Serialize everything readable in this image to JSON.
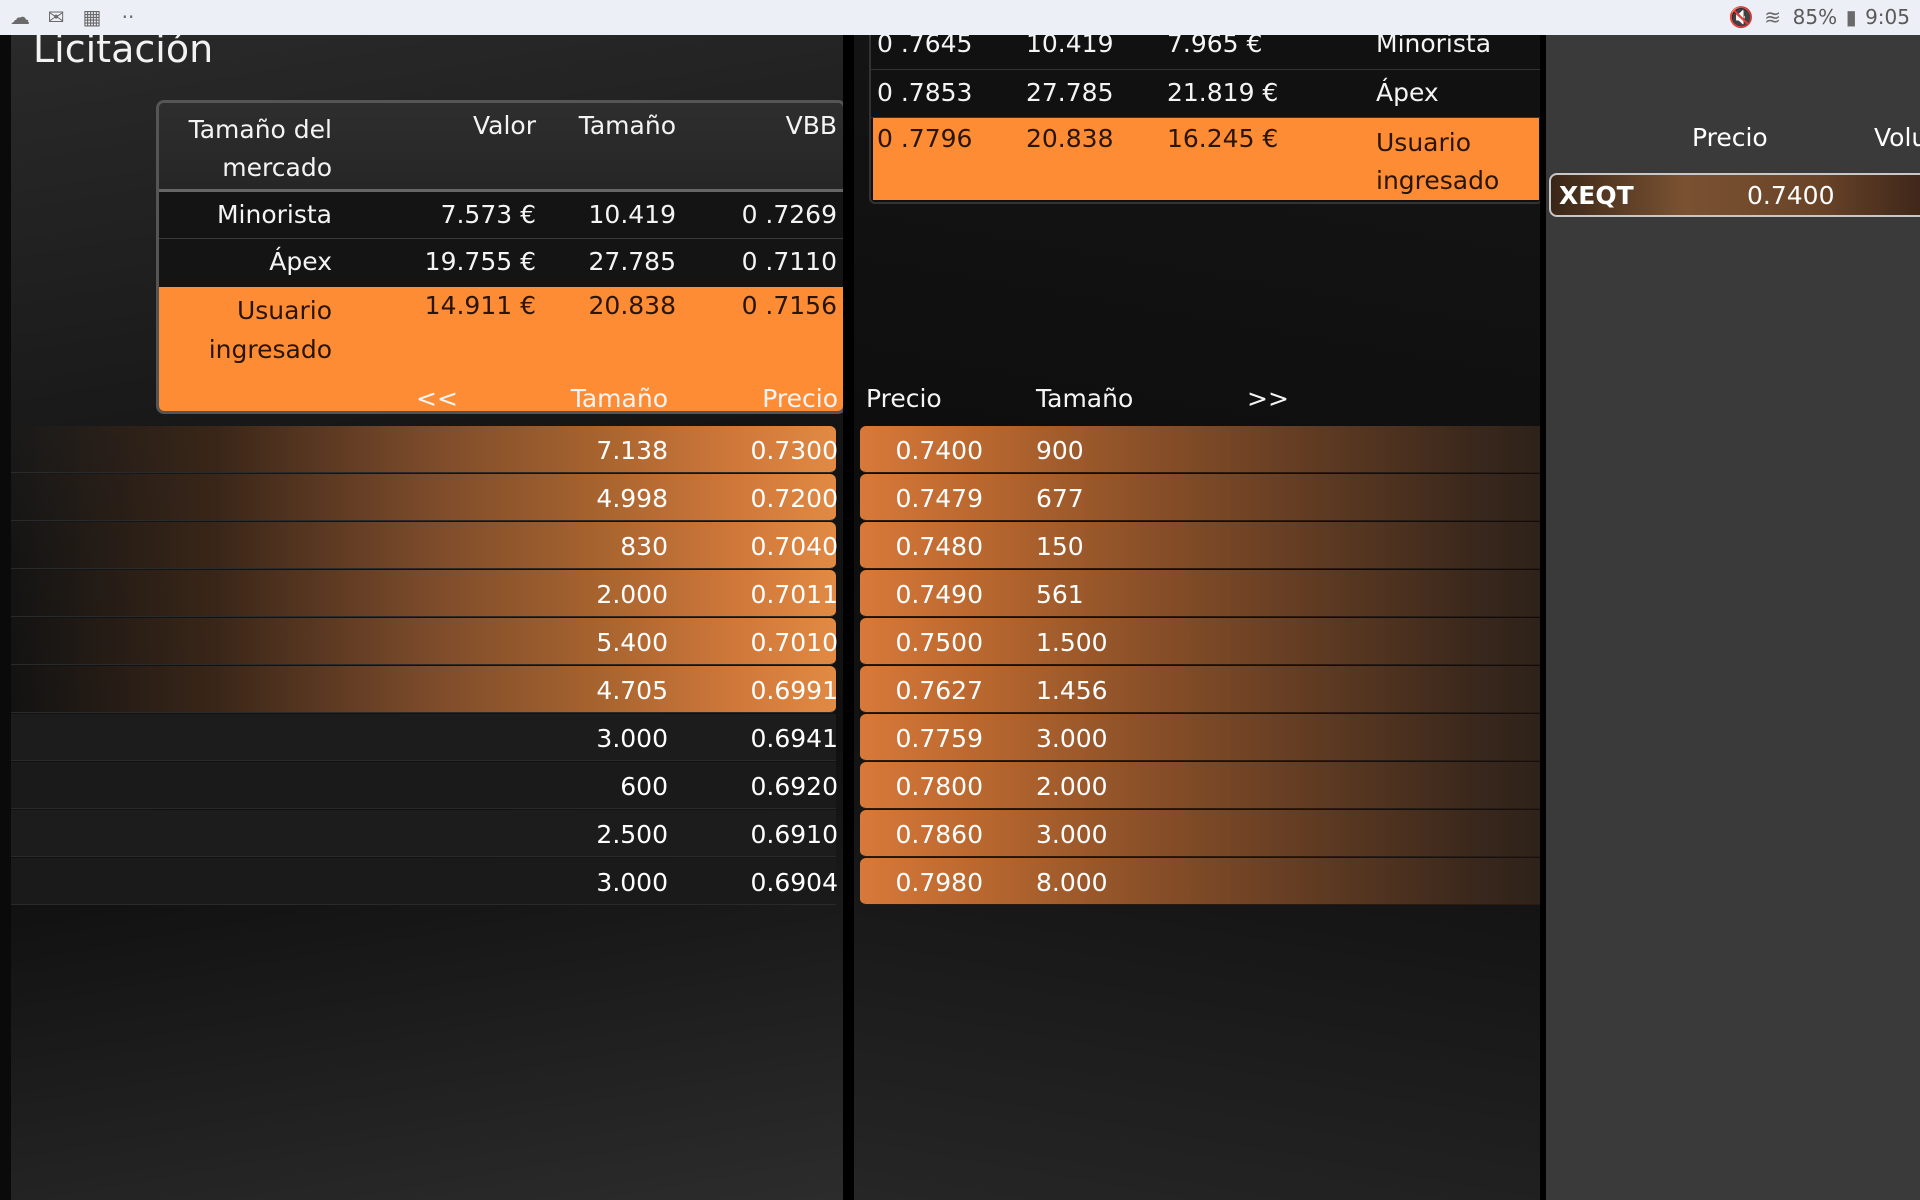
{
  "status_bar": {
    "left_icons": [
      "cloud-icon",
      "mail-icon",
      "gallery-icon",
      "more-dots-icon"
    ],
    "mute_icon": "mute-icon",
    "wifi_icon": "wifi-icon",
    "battery_percent": "85%",
    "battery_icon": "battery-icon",
    "time": "9:05"
  },
  "colors": {
    "accent_orange": "#fe8c34",
    "bar_brown": "#7a4a2a",
    "panel_dark": "#141414",
    "right_panel": "#3a3a3a"
  },
  "bid_panel": {
    "title": "Licitación",
    "summary": {
      "headers": {
        "market_size": "Tamaño del mercado",
        "valor": "Valor",
        "tamano": "Tamaño",
        "vbb": "VBB"
      },
      "rows": [
        {
          "name": "Minorista",
          "valor": "7.573 €",
          "tamano": "10.419",
          "vbb": "0 .7269"
        },
        {
          "name": "Ápex",
          "valor": "19.755 €",
          "tamano": "27.785",
          "vbb": "0 .7110"
        },
        {
          "name": "Usuario ingresado",
          "valor": "14.911 €",
          "tamano": "20.838",
          "vbb": "0 .7156"
        }
      ]
    },
    "ladder_headers": {
      "prev": "<<",
      "tamano": "Tamaño",
      "precio": "Precio"
    },
    "ladder": [
      {
        "size": "7.138",
        "price": "0.7300",
        "highlighted": true,
        "fill": 1.0
      },
      {
        "size": "4.998",
        "price": "0.7200",
        "highlighted": true,
        "fill": 1.0
      },
      {
        "size": "830",
        "price": "0.7040",
        "highlighted": true,
        "fill": 1.0
      },
      {
        "size": "2.000",
        "price": "0.7011",
        "highlighted": true,
        "fill": 1.0
      },
      {
        "size": "5.400",
        "price": "0.7010",
        "highlighted": true,
        "fill": 1.0
      },
      {
        "size": "4.705",
        "price": "0.6991",
        "highlighted": true,
        "fill": 1.0
      },
      {
        "size": "3.000",
        "price": "0.6941",
        "highlighted": false,
        "fill": 0
      },
      {
        "size": "600",
        "price": "0.6920",
        "highlighted": false,
        "fill": 0
      },
      {
        "size": "2.500",
        "price": "0.6910",
        "highlighted": false,
        "fill": 0
      },
      {
        "size": "3.000",
        "price": "0.6904",
        "highlighted": false,
        "fill": 0
      }
    ]
  },
  "ask_panel": {
    "summary": {
      "rows": [
        {
          "vbb": "0 .7645",
          "tamano": "10.419",
          "valor": "7.965 €",
          "name": "Minorista"
        },
        {
          "vbb": "0 .7853",
          "tamano": "27.785",
          "valor": "21.819 €",
          "name": "Ápex"
        },
        {
          "vbb": "0 .7796",
          "tamano": "20.838",
          "valor": "16.245 €",
          "name": "Usuario ingresado"
        }
      ]
    },
    "ladder_headers": {
      "precio": "Precio",
      "tamano": "Tamaño",
      "next": ">>"
    },
    "ladder": [
      {
        "price": "0.7400",
        "size": "900"
      },
      {
        "price": "0.7479",
        "size": "677"
      },
      {
        "price": "0.7480",
        "size": "150"
      },
      {
        "price": "0.7490",
        "size": "561"
      },
      {
        "price": "0.7500",
        "size": "1.500"
      },
      {
        "price": "0.7627",
        "size": "1.456"
      },
      {
        "price": "0.7759",
        "size": "3.000"
      },
      {
        "price": "0.7800",
        "size": "2.000"
      },
      {
        "price": "0.7860",
        "size": "3.000"
      },
      {
        "price": "0.7980",
        "size": "8.000"
      }
    ]
  },
  "watchlist": {
    "headers": {
      "precio": "Precio",
      "volumen": "Volu"
    },
    "rows": [
      {
        "symbol": "XEQT",
        "price": "0.7400"
      }
    ]
  }
}
